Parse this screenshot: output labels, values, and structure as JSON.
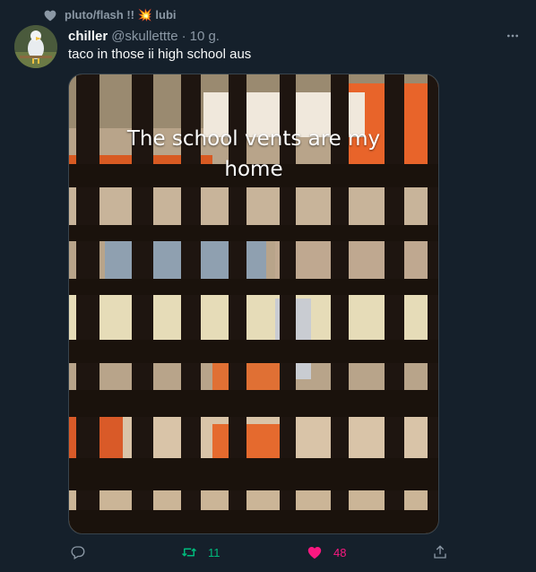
{
  "social_context": {
    "label": "pluto/flash !! 💥 lubi"
  },
  "tweet": {
    "display_name": "chiller",
    "handle": "@skullettte",
    "separator": "·",
    "time": "10 g.",
    "text": "taco in those ii high school aus",
    "media_caption": "The school vents are my home"
  },
  "actions": {
    "replies": "",
    "retweets": "11",
    "likes": "48"
  },
  "colors": {
    "background": "#15202b",
    "secondary_text": "#8b98a5",
    "retweet_active": "#00ba7c",
    "like_active": "#f91880"
  },
  "icons": {
    "social_context": "heart-icon",
    "more": "more-dots-icon",
    "reply": "reply-icon",
    "retweet": "retweet-icon",
    "like": "heart-filled-icon",
    "share": "share-icon"
  }
}
